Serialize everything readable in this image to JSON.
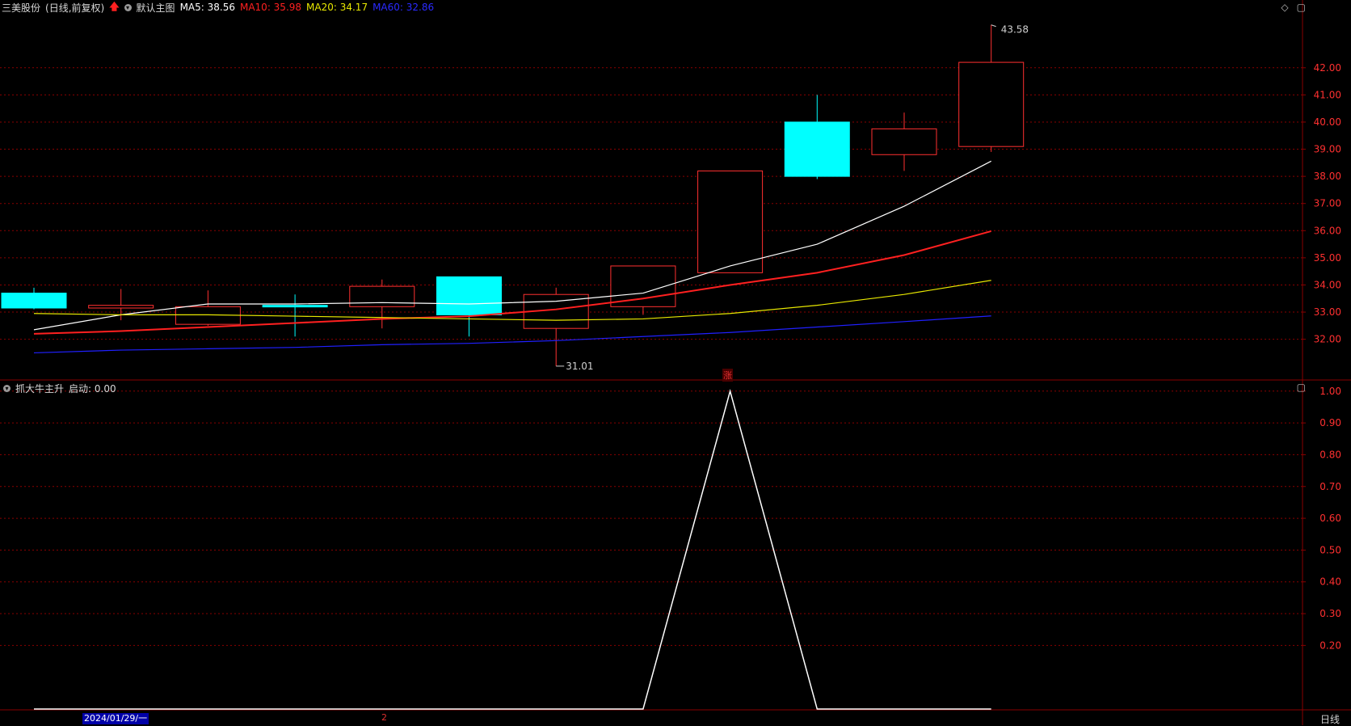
{
  "header": {
    "stock_name": "三美股份",
    "adjust_mode": "(日线,前复权)",
    "template": "默认主图",
    "ma5": "MA5: 38.56",
    "ma10": "MA10: 35.98",
    "ma20": "MA20: 34.17",
    "ma60": "MA60: 32.86"
  },
  "indicator": {
    "name": "抓大牛主升",
    "value": "启动: 0.00"
  },
  "footer": {
    "date": "2024/01/29/一",
    "page": "2",
    "period": "日线"
  },
  "marker": {
    "label": "涨"
  },
  "annotations": {
    "high": "43.58",
    "low": "31.01"
  },
  "colors": {
    "up": "#ff3030",
    "down": "#00ffff",
    "ma5": "#ffffff",
    "ma10": "#ff2020",
    "ma20": "#e8e800",
    "ma60": "#2020ff",
    "grid": "#8a0000",
    "axis": "#d0d0d0",
    "indicator_line": "#ffffff"
  },
  "chart_data": [
    {
      "type": "candlestick",
      "ylim": [
        30.5,
        43.9
      ],
      "y_ticks": [
        "32.00",
        "33.00",
        "34.00",
        "35.00",
        "36.00",
        "37.00",
        "38.00",
        "39.00",
        "40.00",
        "41.00",
        "42.00"
      ],
      "candles": [
        {
          "open": 33.7,
          "close": 33.15,
          "high": 33.9,
          "low": 33.1
        },
        {
          "open": 33.15,
          "close": 33.25,
          "high": 33.85,
          "low": 32.7
        },
        {
          "open": 32.55,
          "close": 33.2,
          "high": 33.8,
          "low": 32.5
        },
        {
          "open": 33.25,
          "close": 33.2,
          "high": 33.65,
          "low": 32.1
        },
        {
          "open": 33.2,
          "close": 33.95,
          "high": 34.2,
          "low": 32.4
        },
        {
          "open": 34.3,
          "close": 32.9,
          "high": 34.3,
          "low": 32.1
        },
        {
          "open": 32.4,
          "close": 33.65,
          "high": 33.9,
          "low": 31.01
        },
        {
          "open": 33.2,
          "close": 34.7,
          "high": 34.7,
          "low": 32.9
        },
        {
          "open": 34.45,
          "close": 38.2,
          "high": 38.2,
          "low": 34.45
        },
        {
          "open": 40.0,
          "close": 38.0,
          "high": 41.0,
          "low": 37.9
        },
        {
          "open": 38.8,
          "close": 39.75,
          "high": 40.35,
          "low": 38.2
        },
        {
          "open": 39.1,
          "close": 42.2,
          "high": 43.58,
          "low": 38.9
        }
      ],
      "ma_series": [
        {
          "key": "ma5",
          "values": [
            32.35,
            32.9,
            33.3,
            33.3,
            33.35,
            33.3,
            33.4,
            33.7,
            34.7,
            35.5,
            36.9,
            38.56
          ]
        },
        {
          "key": "ma10",
          "values": [
            32.2,
            32.3,
            32.45,
            32.6,
            32.75,
            32.85,
            33.1,
            33.5,
            34.0,
            34.45,
            35.1,
            35.98
          ]
        },
        {
          "key": "ma20",
          "values": [
            32.95,
            32.9,
            32.9,
            32.85,
            32.8,
            32.75,
            32.7,
            32.75,
            32.95,
            33.25,
            33.65,
            34.17
          ]
        },
        {
          "key": "ma60",
          "values": [
            31.5,
            31.6,
            31.65,
            31.7,
            31.8,
            31.85,
            31.95,
            32.1,
            32.25,
            32.45,
            32.65,
            32.86
          ]
        }
      ]
    },
    {
      "type": "line",
      "ylim": [
        0.0,
        1.03
      ],
      "y_ticks": [
        "0.20",
        "0.30",
        "0.40",
        "0.50",
        "0.60",
        "0.70",
        "0.80",
        "0.90",
        "1.00"
      ],
      "values": [
        0,
        0,
        0,
        0,
        0,
        0,
        0,
        0,
        1.0,
        0,
        0,
        0
      ]
    }
  ]
}
